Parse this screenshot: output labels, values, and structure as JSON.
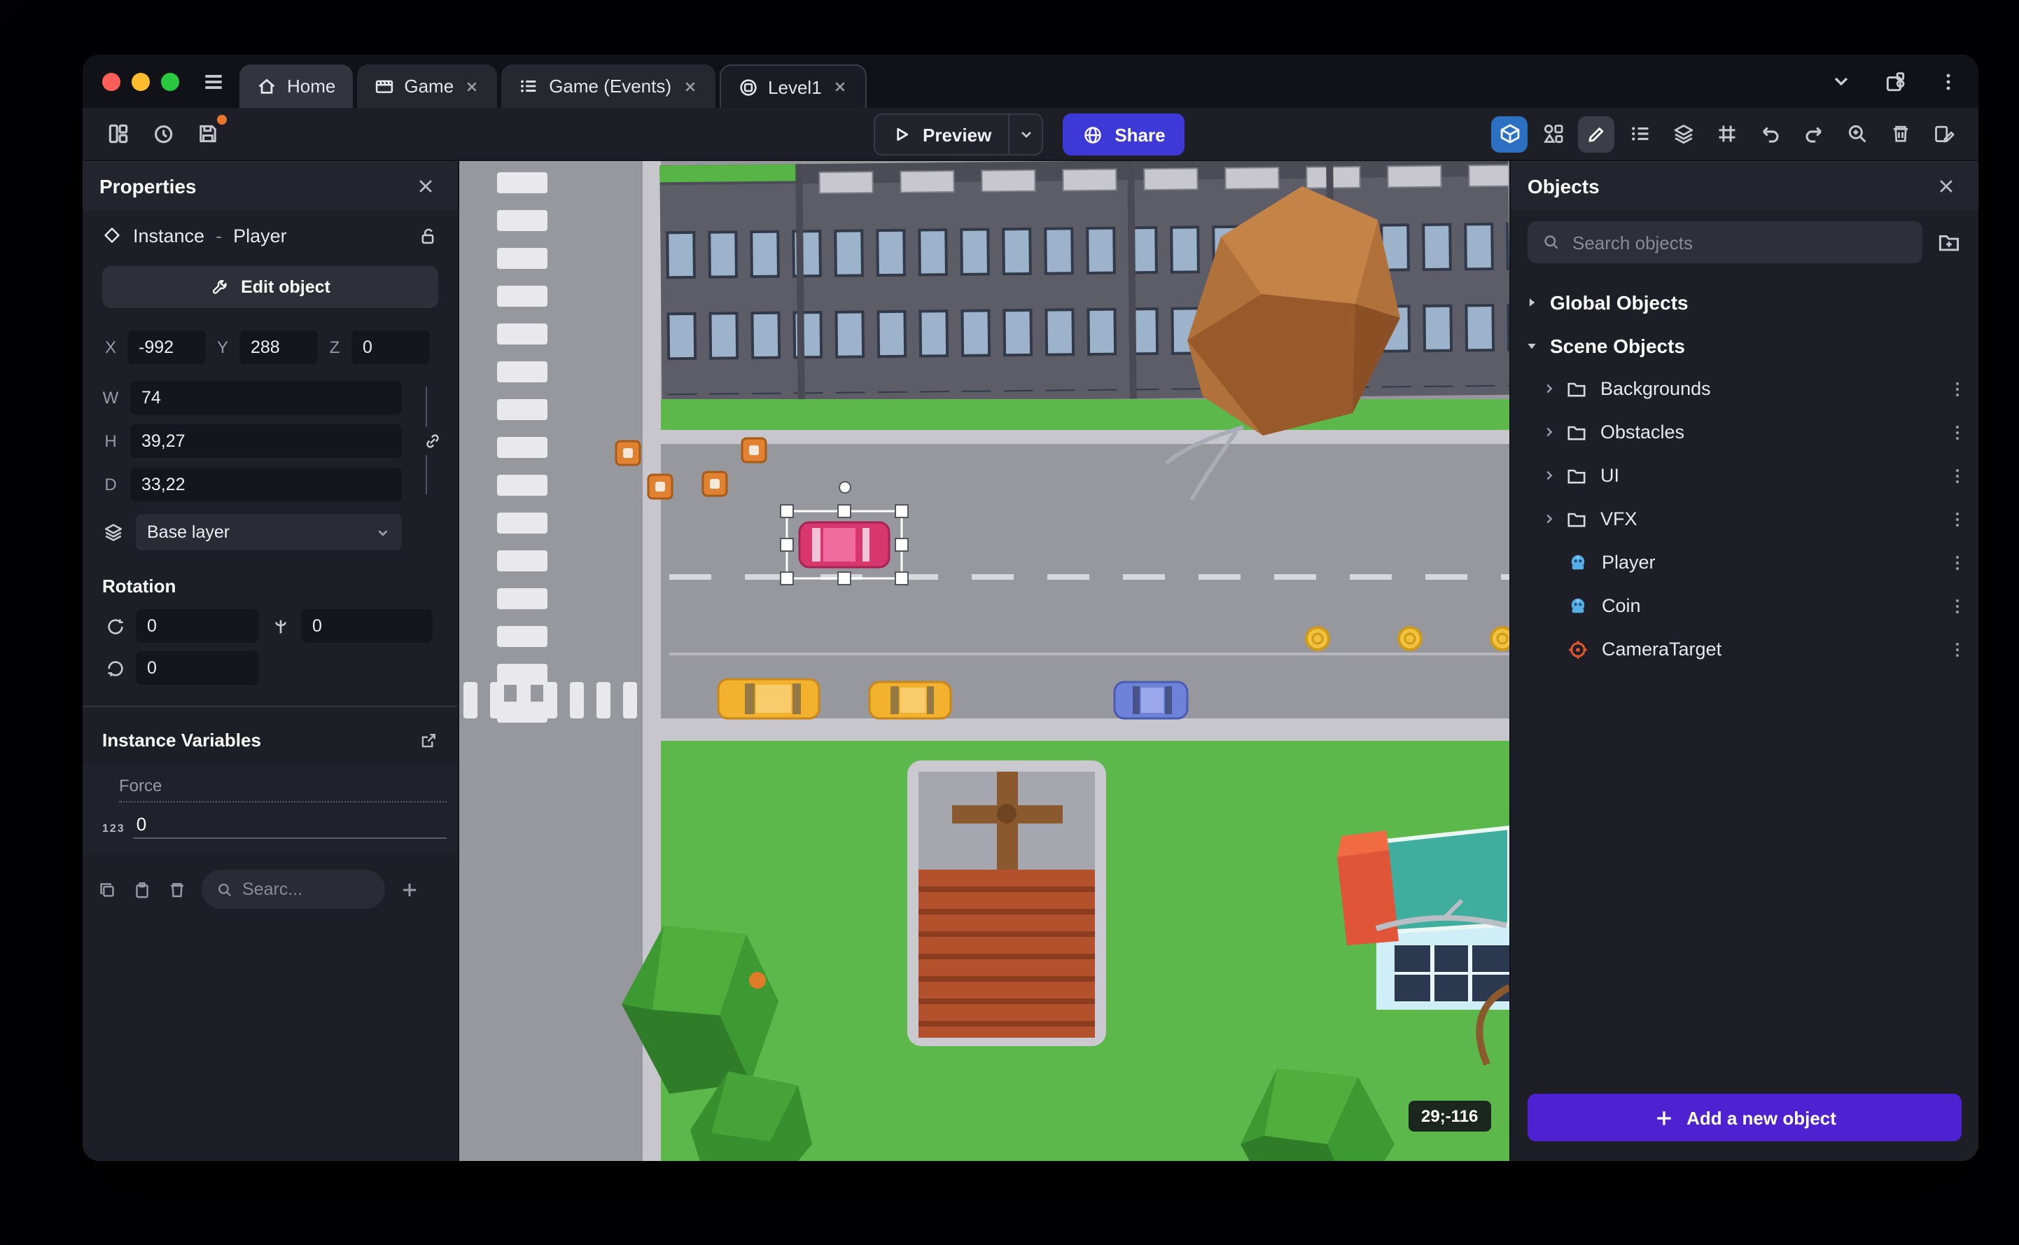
{
  "colors": {
    "accent_purple": "#4e22d0",
    "accent_indigo": "#3d39d6",
    "active_tool_blue": "#2d6fc0",
    "selection_pink": "#d8376e",
    "grass_green": "#5cb84a",
    "road_gray": "#97979e"
  },
  "titlebar": {
    "tabs": [
      {
        "label": "Home"
      },
      {
        "label": "Game"
      },
      {
        "label": "Game (Events)"
      },
      {
        "label": "Level1"
      }
    ]
  },
  "toolbar": {
    "preview_label": "Preview",
    "share_label": "Share"
  },
  "properties": {
    "title": "Properties",
    "instance_type": "Instance",
    "separator": "-",
    "instance_name": "Player",
    "edit_object": "Edit object",
    "x_label": "X",
    "x_value": "-992",
    "y_label": "Y",
    "y_value": "288",
    "z_label": "Z",
    "z_value": "0",
    "w_label": "W",
    "w_value": "74",
    "h_label": "H",
    "h_value": "39,27",
    "d_label": "D",
    "d_value": "33,22",
    "layer_value": "Base layer",
    "rotation_title": "Rotation",
    "rot_x": "0",
    "rot_y": "0",
    "rot_z": "0",
    "variables_title": "Instance Variables",
    "variable_name": "Force",
    "variable_type_badge": "123",
    "variable_value": "0",
    "search_placeholder": "Searc..."
  },
  "canvas": {
    "coords_badge": "29;-116"
  },
  "objects": {
    "title": "Objects",
    "search_placeholder": "Search objects",
    "global_group": "Global Objects",
    "scene_group": "Scene Objects",
    "folders": [
      "Backgrounds",
      "Obstacles",
      "UI",
      "VFX"
    ],
    "items": [
      "Player",
      "Coin",
      "CameraTarget"
    ],
    "add_button": "Add a new object"
  }
}
